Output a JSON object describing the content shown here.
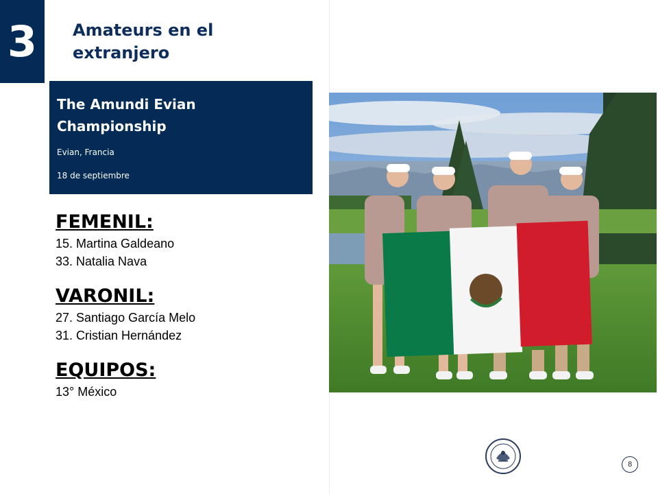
{
  "slide": {
    "section_number": "3",
    "title_line1": "Amateurs en el",
    "title_line2": "extranjero",
    "page_number": "8"
  },
  "event": {
    "name_line1": "The Amundi Evian",
    "name_line2": "Championship",
    "location": "Evian, Francia",
    "date": "18 de septiembre"
  },
  "results": {
    "femenil": {
      "heading": "FEMENIL:",
      "lines": [
        "15. Martina Galdeano",
        "33. Natalia Nava"
      ]
    },
    "varonil": {
      "heading": "VARONIL:",
      "lines": [
        "27. Santiago García Melo",
        "31. Cristian Hernández"
      ]
    },
    "equipos": {
      "heading": "EQUIPOS:",
      "lines": [
        "13° México"
      ]
    }
  },
  "colors": {
    "navy": "#032b55",
    "title_blue": "#0d2e5c",
    "flag_green": "#006847",
    "flag_red": "#ce1126"
  },
  "icons": {
    "logo": "federation-seal-icon"
  }
}
